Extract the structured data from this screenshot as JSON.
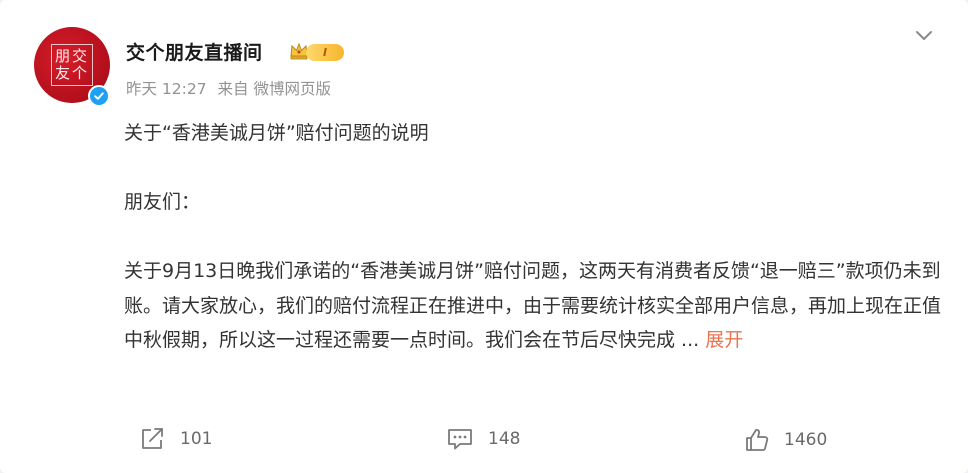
{
  "post": {
    "author": {
      "name": "交个朋友直播间",
      "avatar_text": [
        "交",
        "个",
        "朋",
        "友"
      ],
      "level_badge": "I",
      "verified": true
    },
    "meta": {
      "time": "昨天 12:27",
      "source": "来自 微博网页版"
    },
    "content": {
      "title": "关于“香港美诚月饼”赔付问题的说明",
      "greeting": "朋友们：",
      "body": "关于9月13日晚我们承诺的“香港美诚月饼”赔付问题，这两天有消费者反馈“退一赔三”款项仍未到账。请大家放心，我们的赔付流程正在推进中，由于需要统计核实全部用户信息，再加上现在正值中秋假期，所以这一过程还需要一点时间。我们会在节后尽快完成",
      "ellipsis": " ... ",
      "expand_label": "展开"
    },
    "actions": {
      "repost_count": "101",
      "comment_count": "148",
      "like_count": "1460"
    }
  },
  "colors": {
    "accent_link": "#eb7350",
    "avatar_red": "#c8161d",
    "verified_blue": "#1da1f2",
    "level_gold": "#f7b52c"
  },
  "icons": {
    "menu": "chevron-down-icon",
    "verified": "verified-check-icon",
    "crown": "crown-icon",
    "repost": "repost-icon",
    "comment": "comment-icon",
    "like": "thumbs-up-icon"
  }
}
